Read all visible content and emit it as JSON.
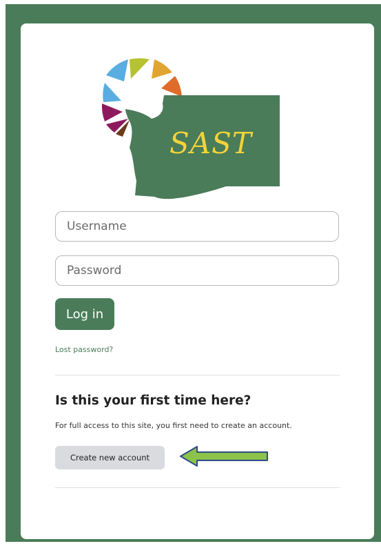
{
  "logo": {
    "text": "SAST",
    "accent_colors": [
      "#b5c232",
      "#e0a531",
      "#e06c2b",
      "#5aade0",
      "#8e1a5e",
      "#888888",
      "#6b3a1a"
    ],
    "state_color": "#4a7c59",
    "text_color": "#f2d338"
  },
  "form": {
    "username_placeholder": "Username",
    "password_placeholder": "Password",
    "login_label": "Log in",
    "lost_password_label": "Lost password?"
  },
  "signup": {
    "title": "Is this your first time here?",
    "description": "For full access to this site, you first need to create an account.",
    "create_label": "Create new account"
  },
  "annotation": {
    "arrow_color": "#8bc34a",
    "arrow_outline": "#2d4a8a",
    "icon": "left-arrow-icon"
  },
  "colors": {
    "brand": "#4a7c59",
    "secondary_button": "#d9dbdf"
  }
}
